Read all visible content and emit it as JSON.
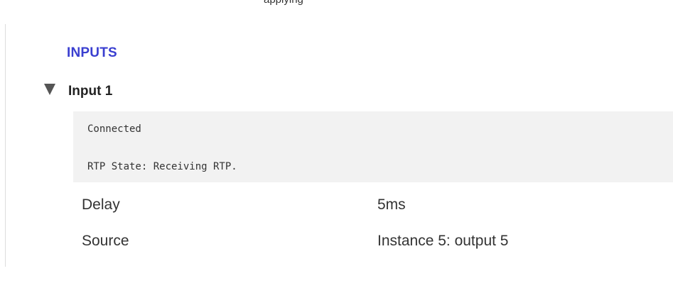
{
  "header_fragment": "applying",
  "section": {
    "title": "INPUTS"
  },
  "input": {
    "title": "Input 1",
    "status_lines": [
      "Connected",
      "RTP State: Receiving RTP."
    ],
    "properties": [
      {
        "key": "Delay",
        "value": "5ms"
      },
      {
        "key": "Source",
        "value": "Instance 5: output 5"
      }
    ]
  },
  "colors": {
    "section_title": "#3a3fd0",
    "status_bg": "#f2f2f2",
    "triangle": "#555555"
  },
  "icons": {
    "collapse": "triangle-down-icon"
  }
}
